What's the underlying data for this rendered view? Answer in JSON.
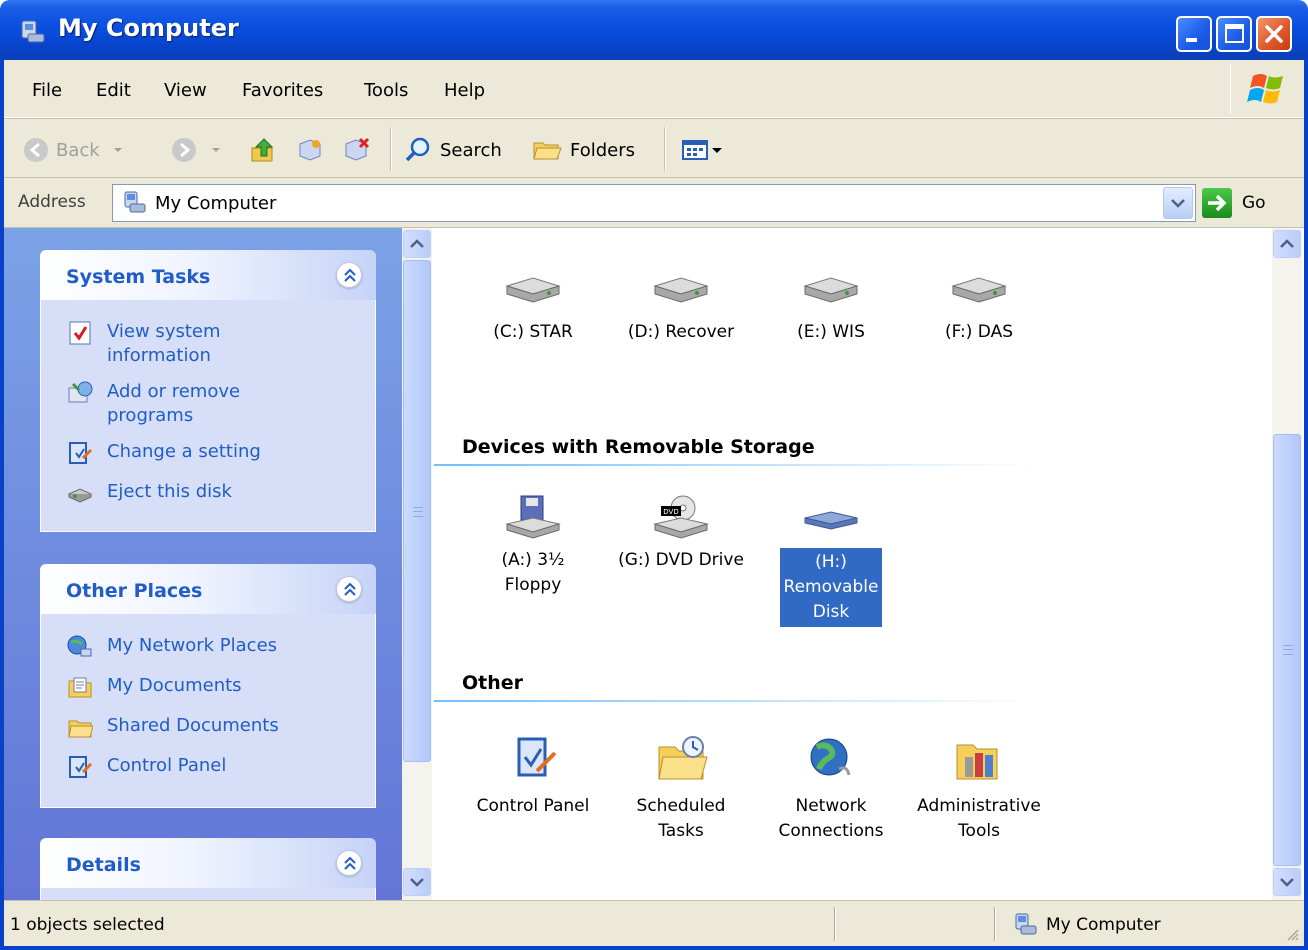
{
  "window": {
    "title": "My Computer",
    "icon": "my-computer-icon"
  },
  "menu": {
    "file": "File",
    "edit": "Edit",
    "view": "View",
    "favorites": "Favorites",
    "tools": "Tools",
    "help": "Help"
  },
  "toolbar": {
    "back": "Back",
    "search": "Search",
    "folders": "Folders"
  },
  "address": {
    "label": "Address",
    "value": "My Computer",
    "go": "Go"
  },
  "left": {
    "system_tasks": {
      "title": "System Tasks",
      "items": [
        {
          "label1": "View system",
          "label2": "information"
        },
        {
          "label1": "Add or remove",
          "label2": "programs"
        },
        {
          "label1": "Change a setting",
          "label2": ""
        },
        {
          "label1": "Eject this disk",
          "label2": ""
        }
      ]
    },
    "other_places": {
      "title": "Other Places",
      "items": [
        "My Network Places",
        "My Documents",
        "Shared Documents",
        "Control Panel"
      ]
    },
    "details": {
      "title": "Details"
    }
  },
  "main": {
    "hard_drives": [
      "(C:) STAR",
      "(D:) Recover",
      "(E:) WIS",
      "(F:) DAS"
    ],
    "removable_header": "Devices with Removable Storage",
    "removable": [
      {
        "line1": "(A:) 3½",
        "line2": "Floppy",
        "line3": ""
      },
      {
        "line1": "(G:) DVD Drive",
        "line2": "",
        "line3": ""
      },
      {
        "line1": "(H:)",
        "line2": "Removable",
        "line3": "Disk"
      }
    ],
    "other_header": "Other",
    "other": [
      {
        "line1": "Control Panel",
        "line2": ""
      },
      {
        "line1": "Scheduled",
        "line2": "Tasks"
      },
      {
        "line1": "Network",
        "line2": "Connections"
      },
      {
        "line1": "Administrative",
        "line2": "Tools"
      }
    ]
  },
  "status": {
    "left": "1 objects selected",
    "right": "My Computer"
  },
  "colors": {
    "title_blue": "#0842c9",
    "link_blue": "#215dc6",
    "selection": "#316ac5",
    "chrome": "#ece9d8"
  }
}
